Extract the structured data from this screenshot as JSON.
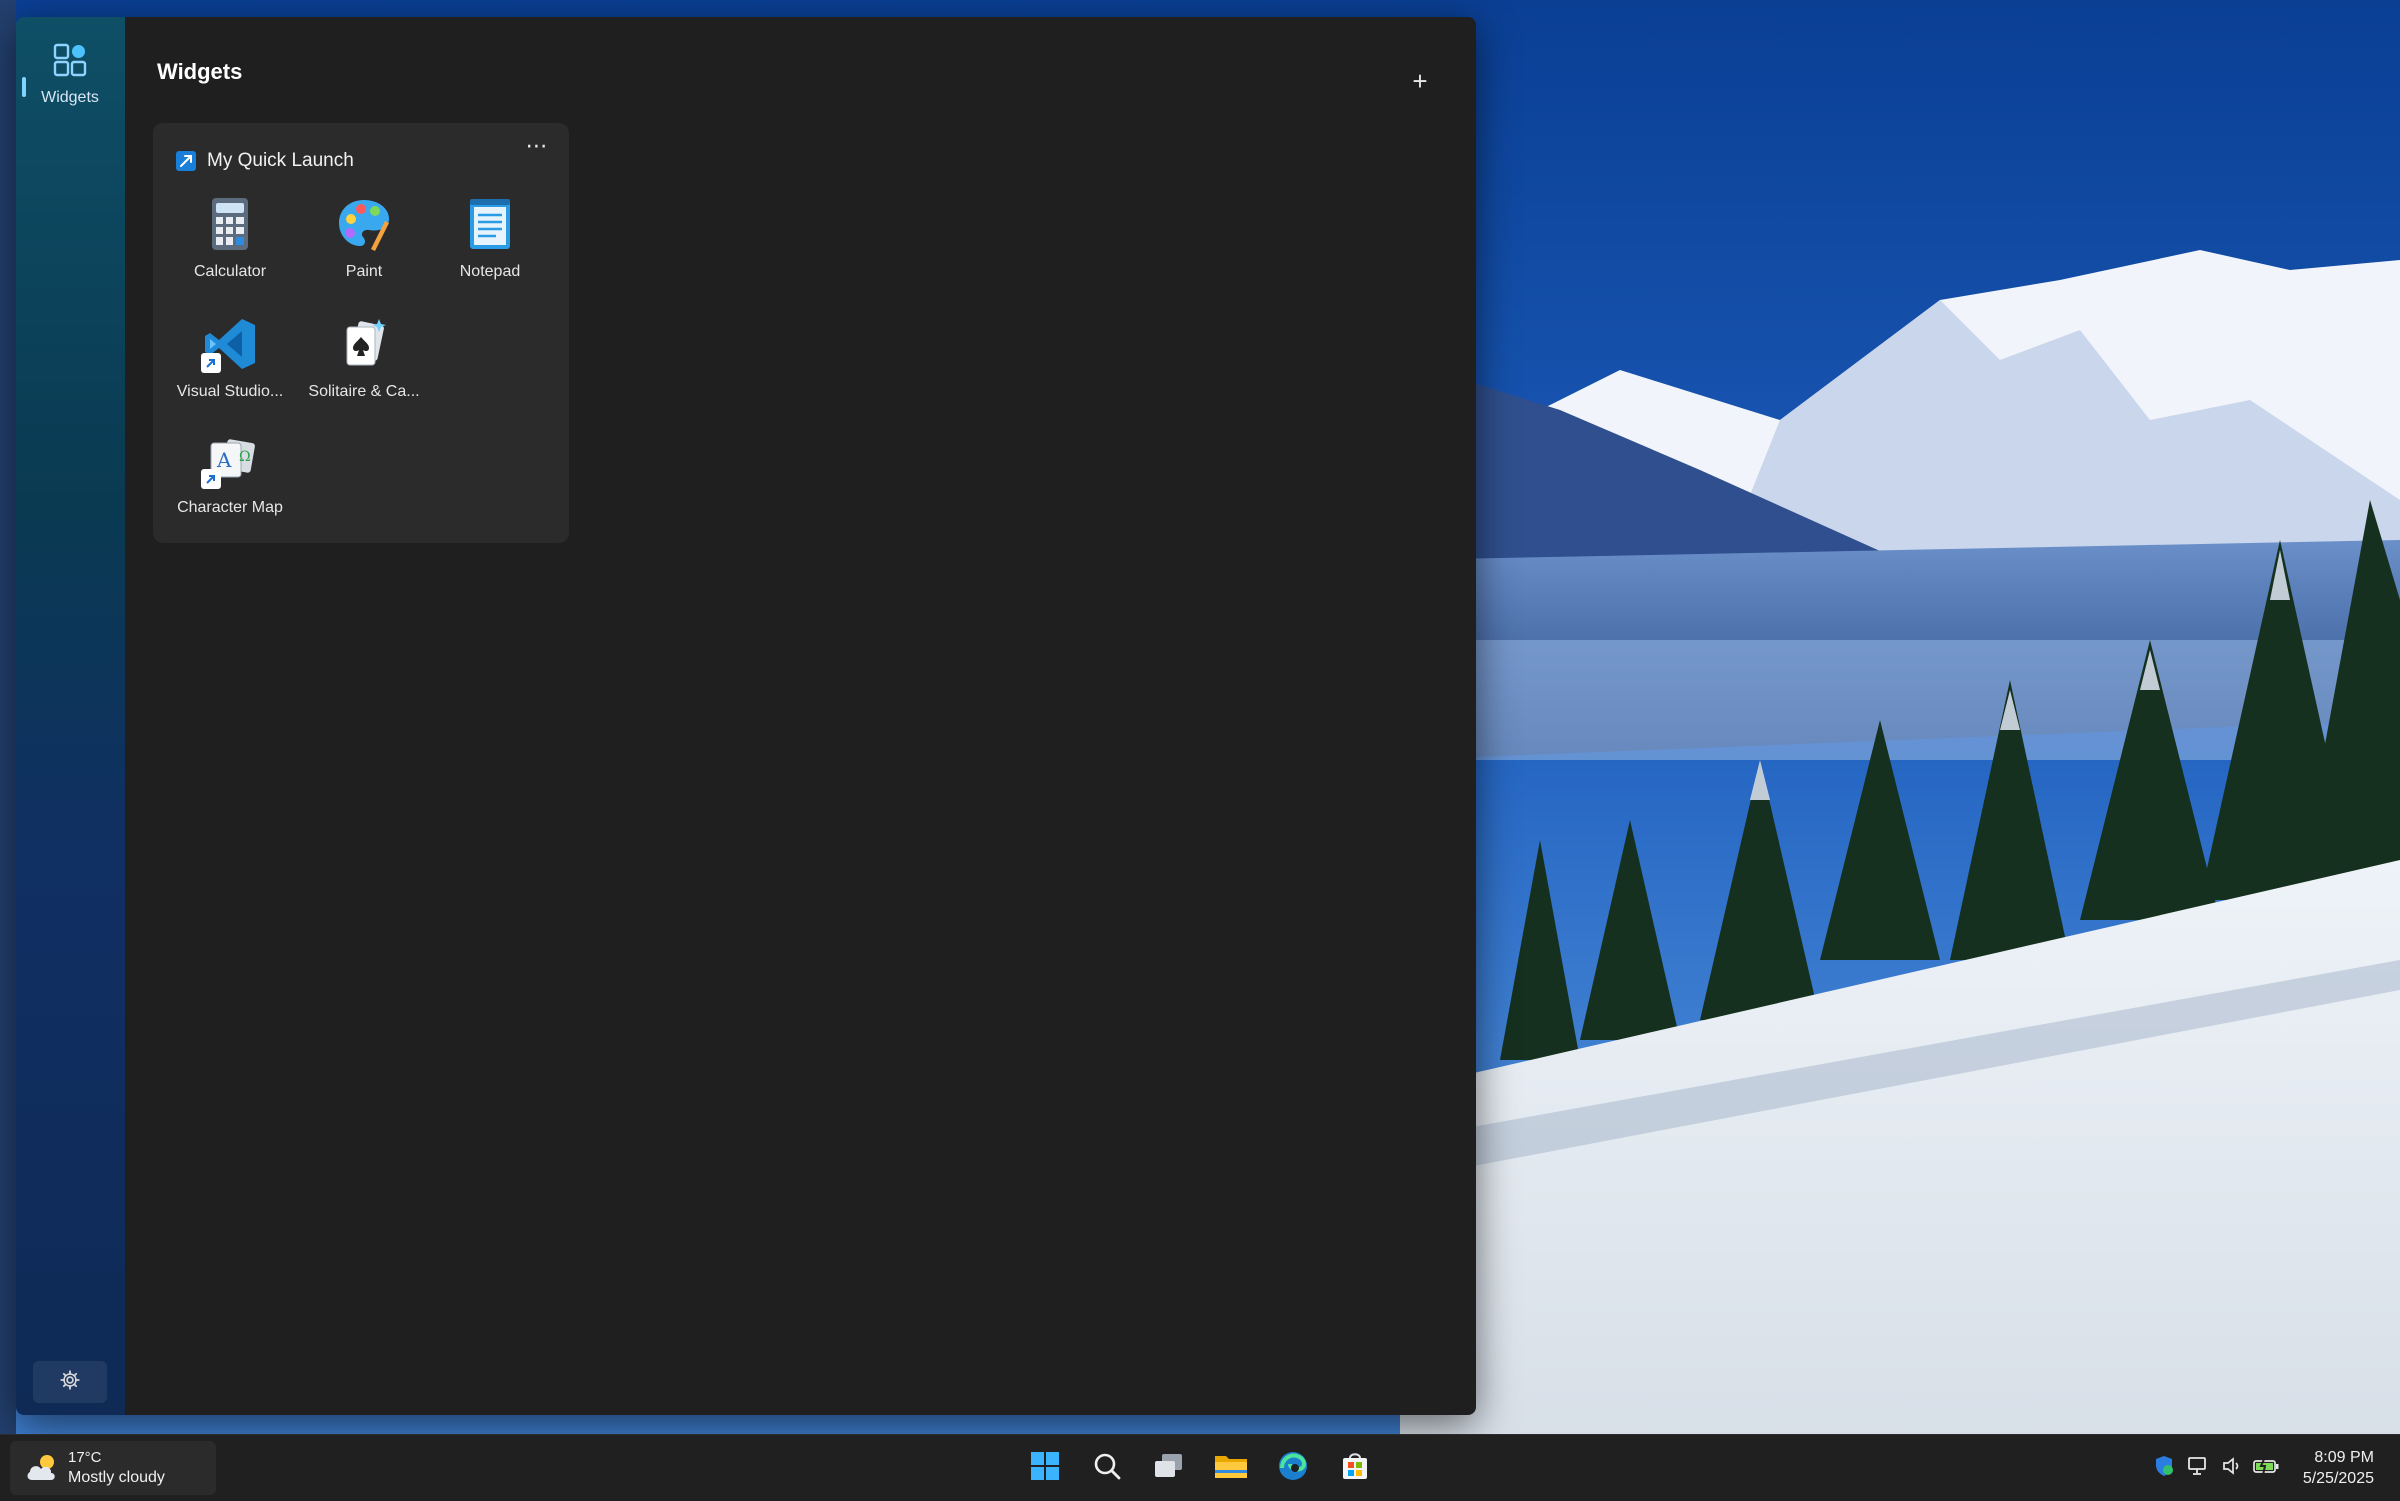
{
  "widgets_board": {
    "title": "Widgets",
    "add_button_label": "+",
    "nav": {
      "label": "Widgets",
      "icon": "widgets-icon"
    },
    "settings_icon": "gear-icon"
  },
  "quick_launch": {
    "title": "My Quick Launch",
    "more_label": "⋯",
    "apps": [
      {
        "label": "Calculator",
        "icon": "calculator-icon"
      },
      {
        "label": "Paint",
        "icon": "paint-palette-icon"
      },
      {
        "label": "Notepad",
        "icon": "notepad-icon"
      },
      {
        "label": "Visual Studio...",
        "icon": "vscode-icon"
      },
      {
        "label": "Solitaire & Ca...",
        "icon": "solitaire-cards-icon"
      },
      {
        "label": "Character Map",
        "icon": "character-map-icon"
      }
    ]
  },
  "taskbar": {
    "weather": {
      "temp": "17°C",
      "condition": "Mostly cloudy",
      "icon": "cloud-sun-icon"
    },
    "pinned": [
      {
        "name": "start",
        "icon": "windows-logo-icon"
      },
      {
        "name": "search",
        "icon": "search-icon"
      },
      {
        "name": "task-view",
        "icon": "task-view-icon"
      },
      {
        "name": "file-explorer",
        "icon": "folder-icon"
      },
      {
        "name": "edge",
        "icon": "edge-icon"
      },
      {
        "name": "store",
        "icon": "store-icon"
      }
    ],
    "tray": [
      "defender-icon",
      "network-icon",
      "volume-icon",
      "battery-icon"
    ],
    "clock": {
      "time": "8:09 PM",
      "date": "5/25/2025"
    }
  },
  "colors": {
    "board_bg": "#1f1f1f",
    "card_bg": "#2b2b2b",
    "taskbar_bg": "#202020",
    "accent": "#4cc2ff"
  }
}
